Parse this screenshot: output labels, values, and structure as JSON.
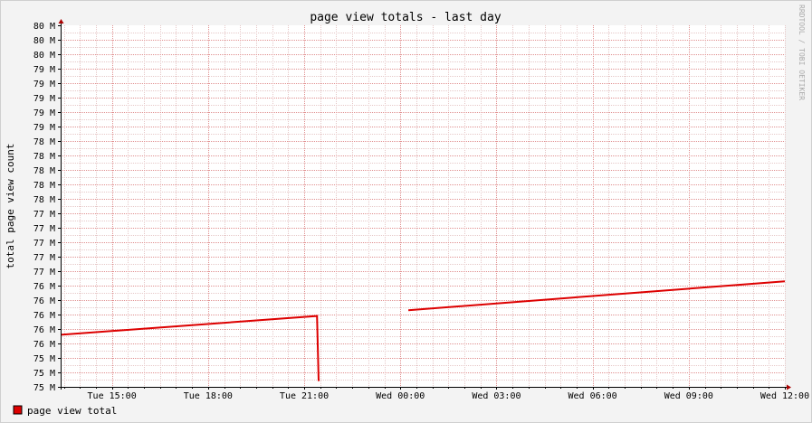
{
  "chart_data": {
    "type": "line",
    "title": "page view totals - last day",
    "ylabel": "total page view count",
    "xlabel": "",
    "watermark": "RRDTOOL / TOBI OETIKER",
    "y_tick_labels": [
      "80 M",
      "80 M",
      "80 M",
      "79 M",
      "79 M",
      "79 M",
      "79 M",
      "79 M",
      "78 M",
      "78 M",
      "78 M",
      "78 M",
      "78 M",
      "77 M",
      "77 M",
      "77 M",
      "77 M",
      "77 M",
      "76 M",
      "76 M",
      "76 M",
      "76 M",
      "76 M",
      "75 M",
      "75 M",
      "75 M"
    ],
    "x_tick_labels": [
      "Tue 15:00",
      "Tue 18:00",
      "Tue 21:00",
      "Wed 00:00",
      "Wed 03:00",
      "Wed 06:00",
      "Wed 09:00",
      "Wed 12:00"
    ],
    "x_hours": [
      15,
      18,
      21,
      24,
      27,
      30,
      33,
      36
    ],
    "xlim_hours": [
      13.4,
      36
    ],
    "ylim": [
      75.0,
      80.0
    ],
    "y_tick_step": 0.2,
    "series": [
      {
        "name": "page view total",
        "color": "#dd0000",
        "segments": [
          [
            [
              13.4,
              75.72
            ],
            [
              21.4,
              75.98
            ],
            [
              21.45,
              75.08
            ]
          ],
          [
            [
              24.25,
              76.06
            ],
            [
              36.0,
              76.46
            ]
          ]
        ]
      }
    ],
    "legend": {
      "placement": "bottom-left"
    },
    "grid": true,
    "colors": {
      "background": "#f3f3f3",
      "plot_area": "#ffffff",
      "grid_minor": "#e6c8c8",
      "grid_major": "#e09090",
      "axis": "#000000",
      "arrow": "#aa0000"
    }
  }
}
